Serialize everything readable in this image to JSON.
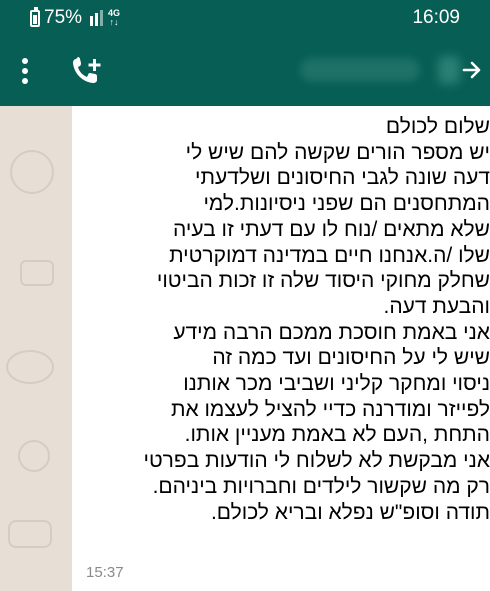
{
  "status_bar": {
    "battery": "75%",
    "network": "4G",
    "time": "16:09"
  },
  "toolbar": {
    "icons": [
      "menu-icon",
      "add-call-icon",
      "forward-icon"
    ]
  },
  "message": {
    "lines": [
      "שלום לכולם",
      "יש מספר הורים שקשה להם שיש לי",
      "דעה שונה לגבי החיסונים ושלדעתי",
      "המתחסנים הם שפני ניסיונות.למי",
      "שלא מתאים /נוח לו עם דעתי זו בעיה",
      "שלו /ה.אנחנו חיים במדינה דמוקרטית",
      "שחלק מחוקי היסוד שלה זו זכות הביטוי",
      "והבעת דעה.",
      "אני באמת חוסכת ממכם הרבה מידע",
      "שיש לי על החיסונים ועד כמה זה",
      "ניסוי ומחקר קליני ושביבי מכר אותנו",
      "לפייזר ומודרנה כדיי להציל לעצמו את",
      "התחת ,העם לא באמת מעניין אותו.",
      "אני מבקשת לא לשלוח לי הודעות בפרטי",
      "רק מה שקשור לילדים וחברויות ביניהם.",
      "תודה וסופ\"ש נפלא ובריא לכולם."
    ],
    "time": "15:37"
  },
  "colors": {
    "header": "#075e54",
    "wallpaper": "#e7ded5",
    "bubble": "#ffffff"
  }
}
